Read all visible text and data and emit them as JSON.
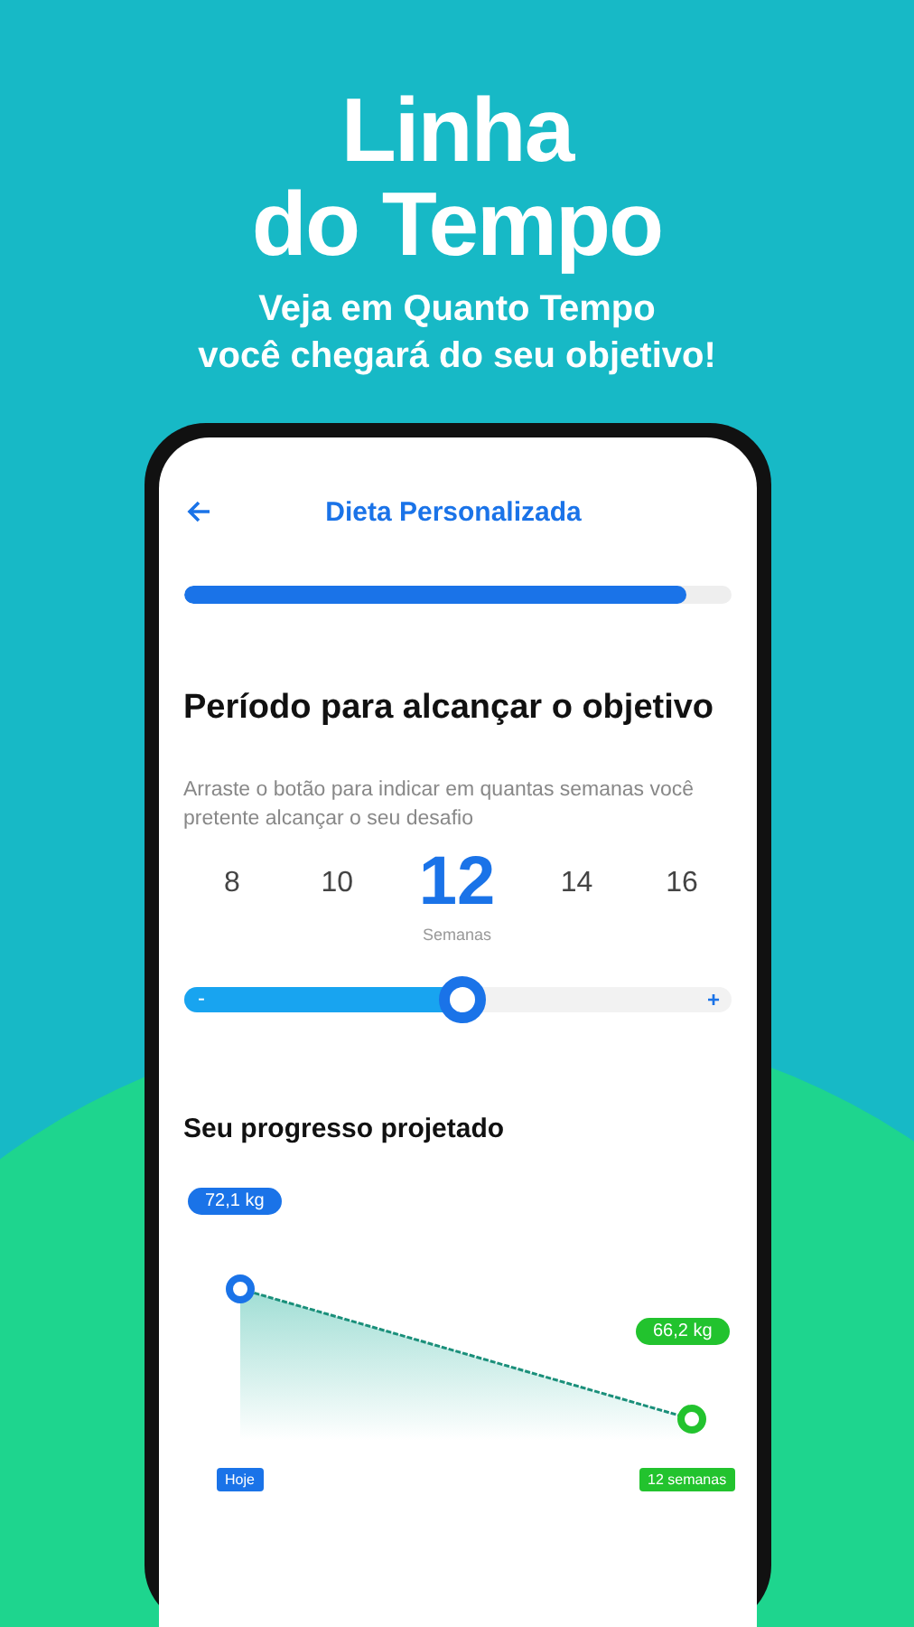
{
  "headline": {
    "title_lines": [
      "Linha",
      "do Tempo"
    ],
    "subtitle_lines": [
      "Veja em Quanto Tempo",
      "você chegará do seu objetivo!"
    ]
  },
  "app_bar": {
    "title": "Dieta Personalizada"
  },
  "step_progress": {
    "level": 0.92
  },
  "section_title": "Período para alcançar o objetivo",
  "instructions": "Arraste o botão para indicar em quantas semanas você pretente alcançar o seu desafio",
  "week_options": [
    {
      "label": "8",
      "selected": false
    },
    {
      "label": "10",
      "selected": false
    },
    {
      "label": "12",
      "selected": true
    },
    {
      "label": "14",
      "selected": false
    },
    {
      "label": "16",
      "selected": false
    }
  ],
  "unit_label": "Semanas",
  "week_slider": {
    "level": 0.51,
    "minus": "-",
    "plus": "+"
  },
  "projection": {
    "title": "Seu progresso projetado",
    "start_weight": "72,1 kg",
    "end_weight": "66,2 kg",
    "start_label": "Hoje",
    "end_label": "12 semanas"
  }
}
